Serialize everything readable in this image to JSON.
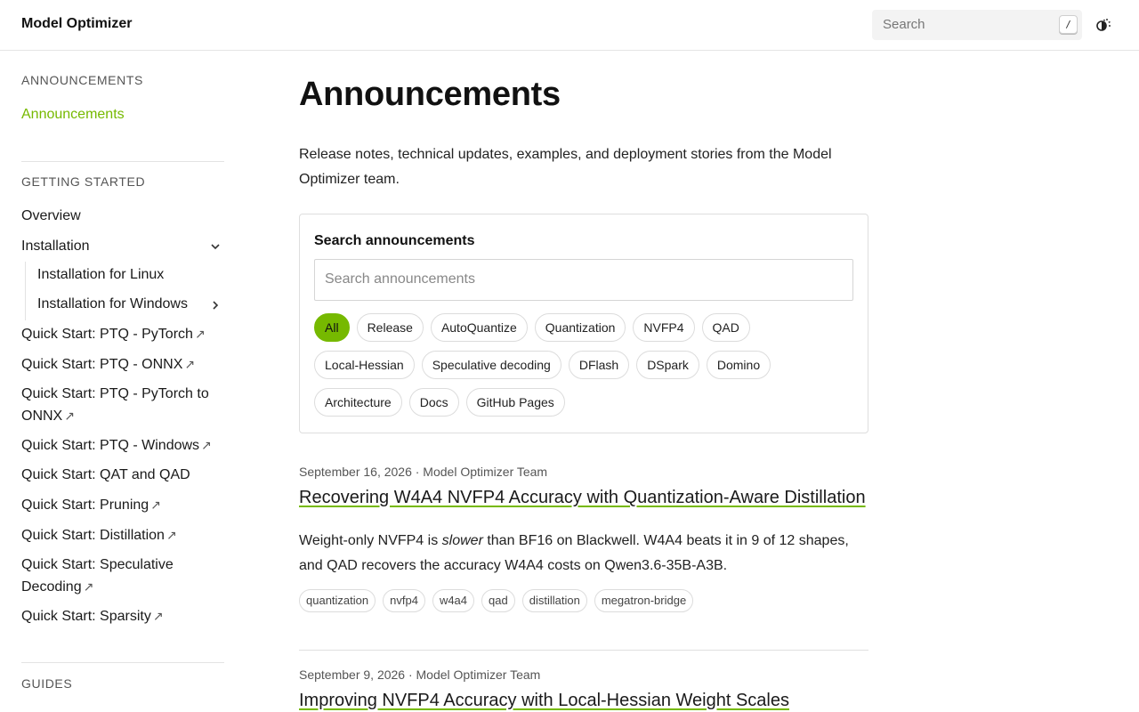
{
  "header": {
    "brand": "Model Optimizer",
    "search_placeholder": "Search",
    "search_shortcut": "/",
    "theme_icon": "theme-toggle-icon"
  },
  "sidebar": {
    "sections": [
      {
        "title": "ANNOUNCEMENTS"
      },
      {
        "title": "GETTING STARTED"
      },
      {
        "title": "GUIDES"
      }
    ],
    "announcements_link": "Announcements",
    "items": [
      {
        "label": "Overview"
      },
      {
        "label": "Installation"
      },
      {
        "label": "Installation for Linux"
      },
      {
        "label": "Installation for Windows"
      },
      {
        "label": "Quick Start: PTQ - PyTorch",
        "ext": "↗"
      },
      {
        "label": "Quick Start: PTQ - ONNX",
        "ext": "↗"
      },
      {
        "label": "Quick Start: PTQ - PyTorch to ONNX",
        "ext": "↗"
      },
      {
        "label": "Quick Start: PTQ - Windows",
        "ext": "↗"
      },
      {
        "label": "Quick Start: QAT and QAD"
      },
      {
        "label": "Quick Start: Pruning",
        "ext": "↗"
      },
      {
        "label": "Quick Start: Distillation",
        "ext": "↗"
      },
      {
        "label": "Quick Start: Speculative Decoding",
        "ext": "↗"
      },
      {
        "label": "Quick Start: Sparsity",
        "ext": "↗"
      }
    ]
  },
  "main": {
    "title": "Announcements",
    "intro": "Release notes, technical updates, examples, and deployment stories from the Model Optimizer team.",
    "search_card": {
      "title": "Search announcements",
      "placeholder": "Search announcements",
      "chips": [
        "All",
        "Release",
        "AutoQuantize",
        "Quantization",
        "NVFP4",
        "QAD",
        "Local-Hessian",
        "Speculative decoding",
        "DFlash",
        "DSpark",
        "Domino",
        "Architecture",
        "Docs",
        "GitHub Pages"
      ],
      "active_chip": "All"
    },
    "posts": [
      {
        "meta": "September 16, 2026 · Model Optimizer Team",
        "title": "Recovering W4A4 NVFP4 Accuracy with Quantization-Aware Distillation",
        "summary_pre": "Weight-only NVFP4 is ",
        "summary_em": "slower",
        "summary_post": " than BF16 on Blackwell. W4A4 beats it in 9 of 12 shapes, and QAD recovers the accuracy W4A4 costs on Qwen3.6-35B-A3B.",
        "tags": [
          "quantization",
          "nvfp4",
          "w4a4",
          "qad",
          "distillation",
          "megatron-bridge"
        ]
      },
      {
        "meta": "September 9, 2026 · Model Optimizer Team",
        "title": "Improving NVFP4 Accuracy with Local-Hessian Weight Scales"
      }
    ]
  },
  "colors": {
    "accent": "#76b900",
    "text": "#1a1a1a",
    "muted": "#555555",
    "border": "#dedede"
  }
}
